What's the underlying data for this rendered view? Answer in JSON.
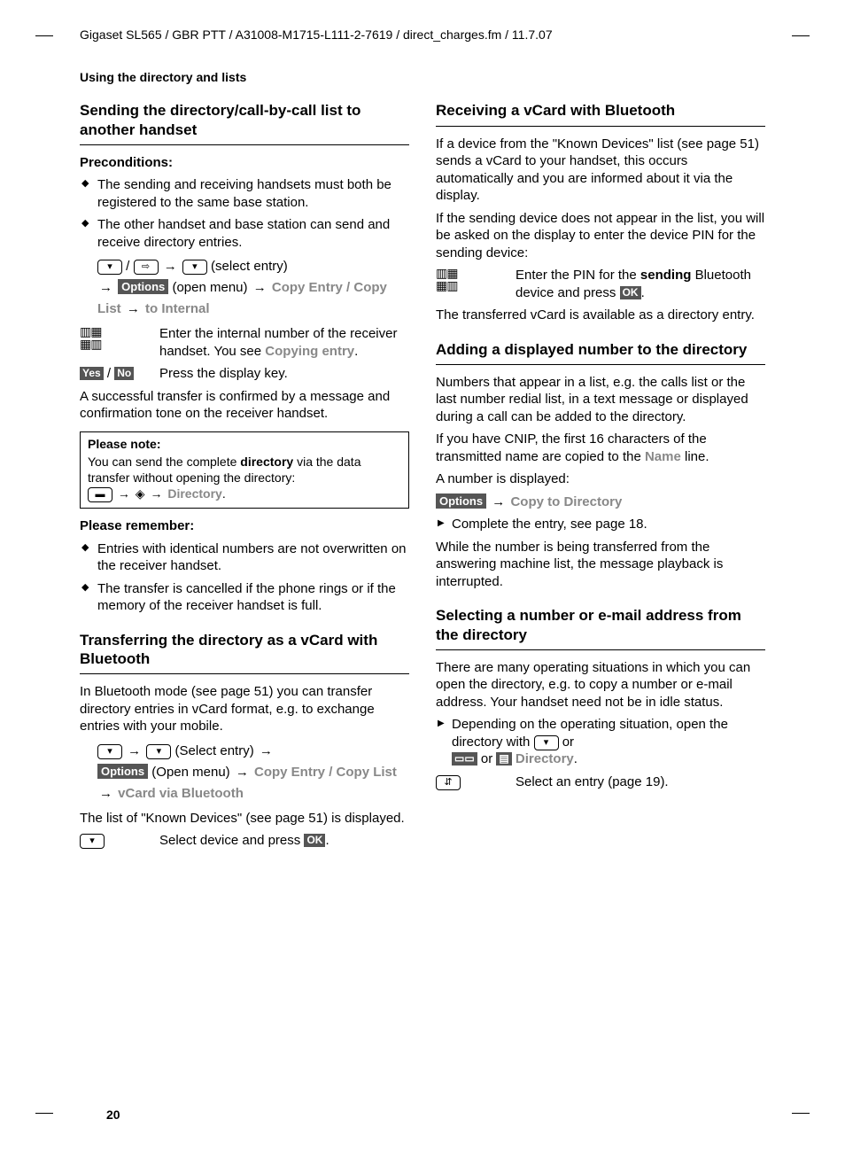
{
  "header": "Gigaset SL565 / GBR PTT / A31008-M1715-L111-2-7619 / direct_charges.fm / 11.7.07",
  "section_label": "Using the directory and lists",
  "page_number": "20",
  "left": {
    "h2_sending": "Sending the directory/call-by-call list to another handset",
    "h3_precond": "Preconditions:",
    "precond_items": [
      "The sending and receiving handsets must both be registered to the same base station.",
      "The other handset and base station can send and receive directory entries."
    ],
    "step1_select": "(select entry)",
    "step1_openmenu": "(open menu)",
    "options_label": "Options",
    "menu_copy_entry": "Copy Entry",
    "menu_copy_list": "Copy List",
    "menu_to_internal": "to Internal",
    "def1_text": "Enter the internal number of the receiver handset. You see ",
    "def1_copying": "Copying entry",
    "yes_label": "Yes",
    "no_label": "No",
    "def2_text": "Press the display key.",
    "after_transfer": "A successful transfer is confirmed by a message and confirmation tone on the receiver handset.",
    "note_title": "Please note:",
    "note_body1": "You can send the complete ",
    "note_bold": "directory",
    "note_body2": " via the data transfer without opening the directory:",
    "note_menu": "Directory",
    "h3_remember": "Please remember:",
    "remember_items": [
      "Entries with identical numbers are not overwritten on the receiver handset.",
      "The transfer is cancelled if the phone rings or if the memory of the receiver handset is full."
    ],
    "h2_transfer_bt": "Transferring the directory as a vCard with Bluetooth",
    "bt_intro": "In Bluetooth mode (see page 51) you can transfer directory entries in vCard format, e.g. to exchange entries with your mobile.",
    "bt_select": "(Select entry)",
    "bt_openmenu": "(Open menu)",
    "menu_vcard_bt": "vCard via Bluetooth",
    "bt_known": "The list of \"Known Devices\" (see page 51) is displayed.",
    "bt_select_device": "Select device and press ",
    "ok_label": "OK"
  },
  "right": {
    "h2_recv": "Receiving a vCard with Bluetooth",
    "recv_p1": "If a device from the \"Known Devices\" list (see page 51) sends a vCard to your handset, this occurs automatically and you are informed about it via the display.",
    "recv_p2": "If the sending device does not appear in the list, you will be asked on the display to enter the device PIN for the sending device:",
    "recv_def_pre": "Enter the PIN for the ",
    "recv_def_bold": "sending",
    "recv_def_post": " Bluetooth device and press ",
    "recv_after": "The transferred vCard is available as a directory entry.",
    "h2_add": "Adding a displayed number to the directory",
    "add_p1": "Numbers that appear in a list, e.g. the calls list or the last number redial list, in a text message or displayed during a call can be added to the directory.",
    "add_p2_pre": "If you have CNIP, the first 16 characters of the transmitted name are copied to the ",
    "add_name": "Name",
    "add_p2_post": " line.",
    "add_disp": "A number is displayed:",
    "menu_copy_dir": "Copy to Directory",
    "add_complete": "Complete the entry, see page 18.",
    "add_while": "While the number is being transferred from the answering machine list, the message playback is interrupted.",
    "h2_select": "Selecting a number or e-mail address from the directory",
    "sel_p1": "There are many operating situations in which you can open the directory, e.g. to copy a number or e-mail address. Your handset need not be in idle status.",
    "sel_tri_pre": "Depending on the operating situation, open the directory with ",
    "sel_tri_or": " or ",
    "sel_dir": "Directory",
    "sel_def": "Select an entry (page 19)."
  }
}
